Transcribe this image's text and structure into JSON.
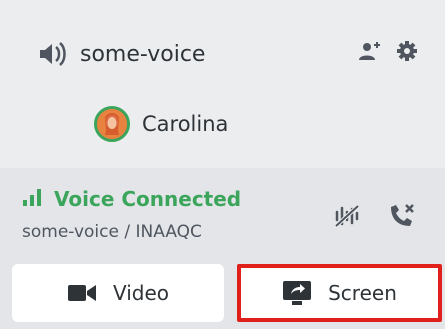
{
  "channel": {
    "name": "some-voice",
    "icons": [
      "speaker-icon",
      "add-member-icon",
      "gear-icon"
    ]
  },
  "user": {
    "name": "Carolina",
    "avatar_ring_color": "#3ba55c"
  },
  "voice_panel": {
    "status": "Voice Connected",
    "subtitle": "some-voice / INAAQC",
    "status_color": "#3ba55c",
    "icons": [
      "signal-bars-icon",
      "noise-suppression-icon",
      "disconnect-call-icon"
    ]
  },
  "buttons": {
    "video_label": "Video",
    "screen_label": "Screen"
  },
  "colors": {
    "highlight": "#e0201b",
    "background": "#ebedef",
    "panel": "#e3e5e8"
  }
}
